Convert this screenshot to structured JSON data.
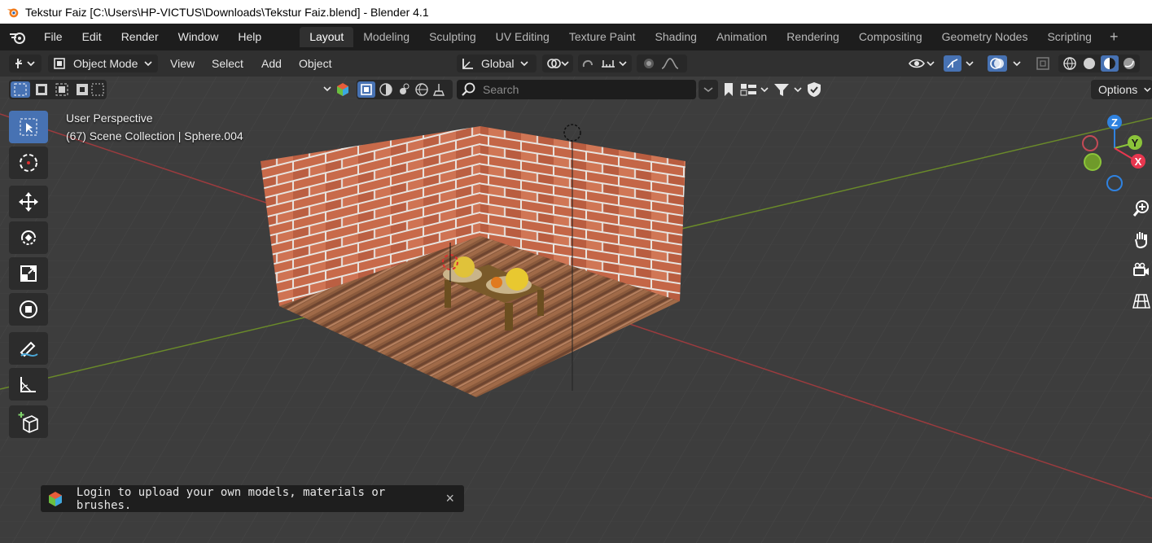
{
  "window": {
    "title": "Tekstur Faiz [C:\\Users\\HP-VICTUS\\Downloads\\Tekstur Faiz.blend] - Blender 4.1"
  },
  "menu": {
    "items": [
      "File",
      "Edit",
      "Render",
      "Window",
      "Help"
    ]
  },
  "workspaces": {
    "active": "Layout",
    "tabs": [
      "Layout",
      "Modeling",
      "Sculpting",
      "UV Editing",
      "Texture Paint",
      "Shading",
      "Animation",
      "Rendering",
      "Compositing",
      "Geometry Nodes",
      "Scripting"
    ],
    "add_label": "+"
  },
  "header": {
    "mode": "Object Mode",
    "menus": [
      "View",
      "Select",
      "Add",
      "Object"
    ],
    "transform_orientation": "Global"
  },
  "subheader": {
    "search_placeholder": "Search",
    "options_label": "Options"
  },
  "viewport": {
    "view_name": "User Perspective",
    "collection_info": "(67) Scene Collection | Sphere.004"
  },
  "gizmo": {
    "z": "Z",
    "y": "Y",
    "x": "X",
    "colors": {
      "x": "#e8374f",
      "y": "#8bc43a",
      "z": "#2f82e0"
    }
  },
  "toast": {
    "message": "Login to upload your own models, materials or brushes.",
    "close_glyph": "×"
  },
  "colors": {
    "accent": "#4772b3",
    "background": "#3d3d3d"
  }
}
